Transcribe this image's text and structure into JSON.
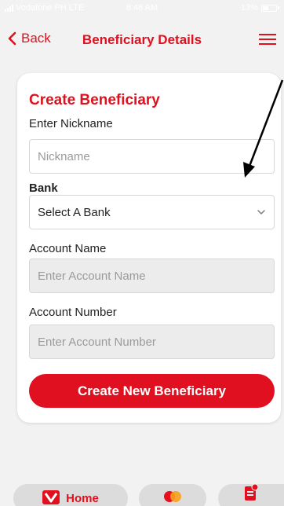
{
  "status_bar": {
    "carrier": "Vodafone PH LTE",
    "time": "8:46 AM",
    "battery": "13%"
  },
  "nav": {
    "back_label": "Back",
    "title": "Beneficiary Details"
  },
  "form": {
    "title": "Create Beneficiary",
    "nickname_label": "Enter Nickname",
    "nickname_placeholder": "Nickname",
    "bank_label": "Bank",
    "bank_selected": "Select A Bank",
    "account_name_label": "Account Name",
    "account_name_placeholder": "Enter Account Name",
    "account_number_label": "Account Number",
    "account_number_placeholder": "Enter Account Number",
    "submit_label": "Create New Beneficiary"
  },
  "tab_bar": {
    "home_label": "Home"
  },
  "colors": {
    "accent": "#e0101e",
    "button": "#e01020",
    "background": "#f2f2f2"
  }
}
